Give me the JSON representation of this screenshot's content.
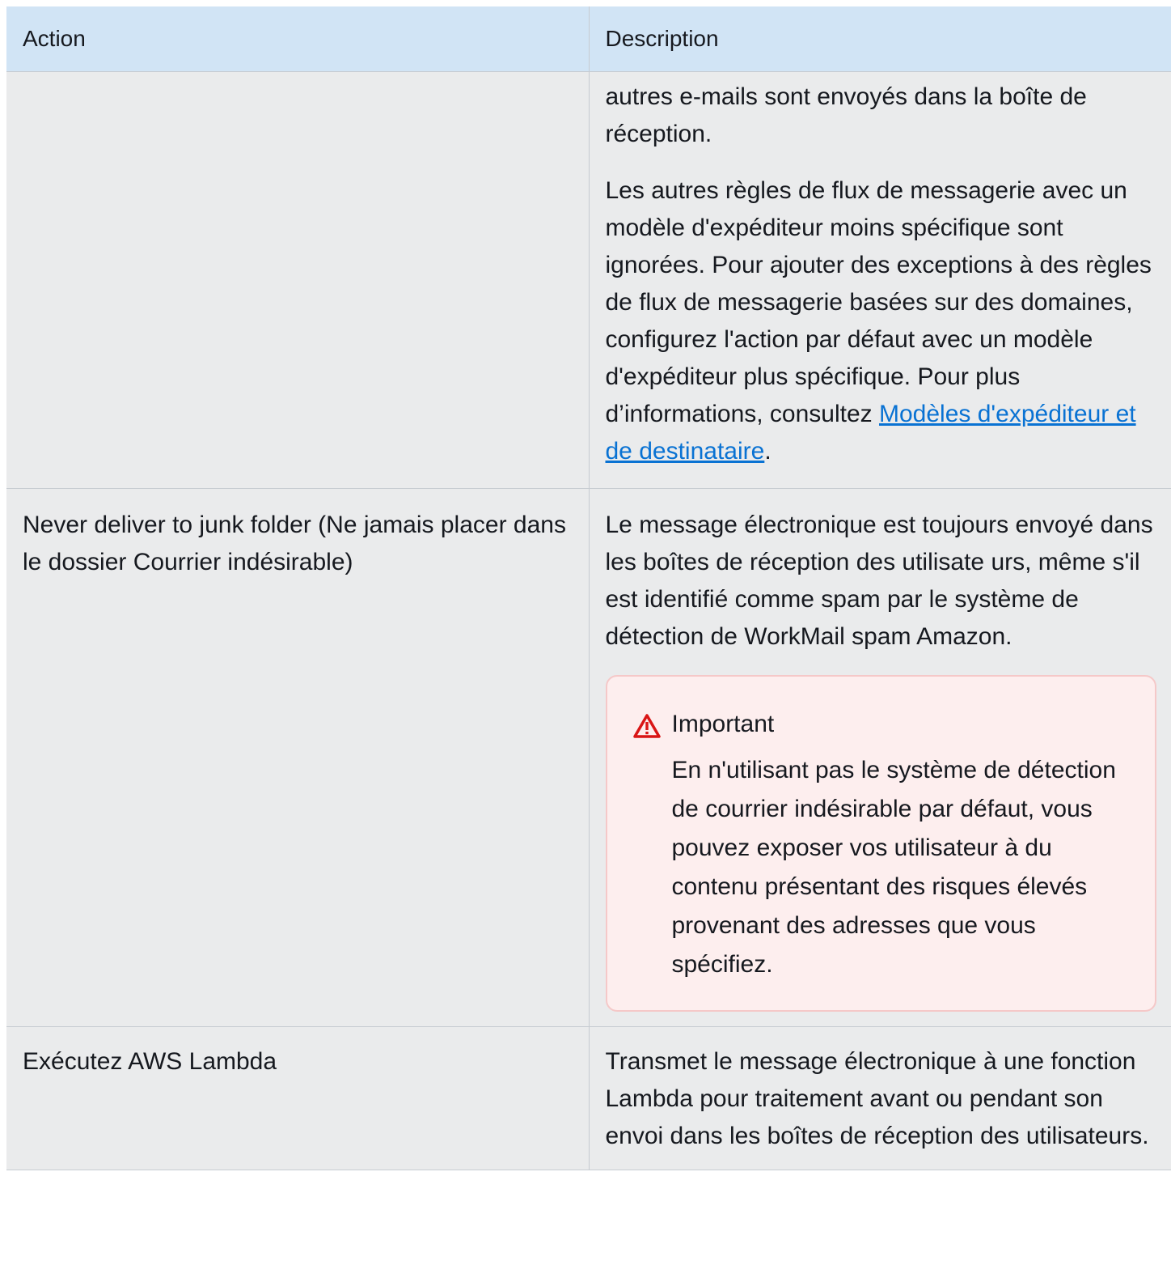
{
  "table": {
    "headers": [
      "Action",
      "Description"
    ],
    "row1": {
      "action": "",
      "desc_p1": "autres e-mails sont envoyés dans la boîte de réception.",
      "desc_p2_text": "Les autres règles de flux de messagerie avec un modèle d'expéditeur moins spécifique sont ignorées. Pour ajouter des exceptions à des règles de flux de messagerie basées sur des domaines, configurez l'action par défaut avec un modèle d'expéditeur plus spécifique. Pour plus d’informations, consultez ",
      "desc_p2_link": "Modèles d'expéditeur et de destinataire",
      "desc_p2_end": "."
    },
    "row2": {
      "action": "Never deliver to junk folder (Ne jamais placer dans le dossier Courrier indésirable)",
      "desc_p1": "Le message électronique est toujours envoyé dans les boîtes de réception des utilisate urs, même s'il est identifié comme spam par le système de détection de WorkMail spam Amazon.",
      "alert_title": "Important",
      "alert_body": "En n'utilisant pas le système de détection de courrier indésirable par défaut, vous pouvez exposer vos utilisateur à du contenu présentant des risques élevés provenant des adresses que vous spécifiez.",
      "alert_icon": "warning-triangle-icon"
    },
    "row3": {
      "action": "Exécutez AWS Lambda",
      "desc_p1": "Transmet le message électronique à une fonction Lambda pour traitement avant ou pendant son envoi dans les boîtes de réception des utilisateurs."
    }
  },
  "colors": {
    "header_bg": "#d1e4f5",
    "cell_bg": "#eaebec",
    "link": "#0972d3",
    "alert_bg": "#fdeeee",
    "alert_border": "#f5c8c8",
    "alert_icon": "#d91515"
  }
}
